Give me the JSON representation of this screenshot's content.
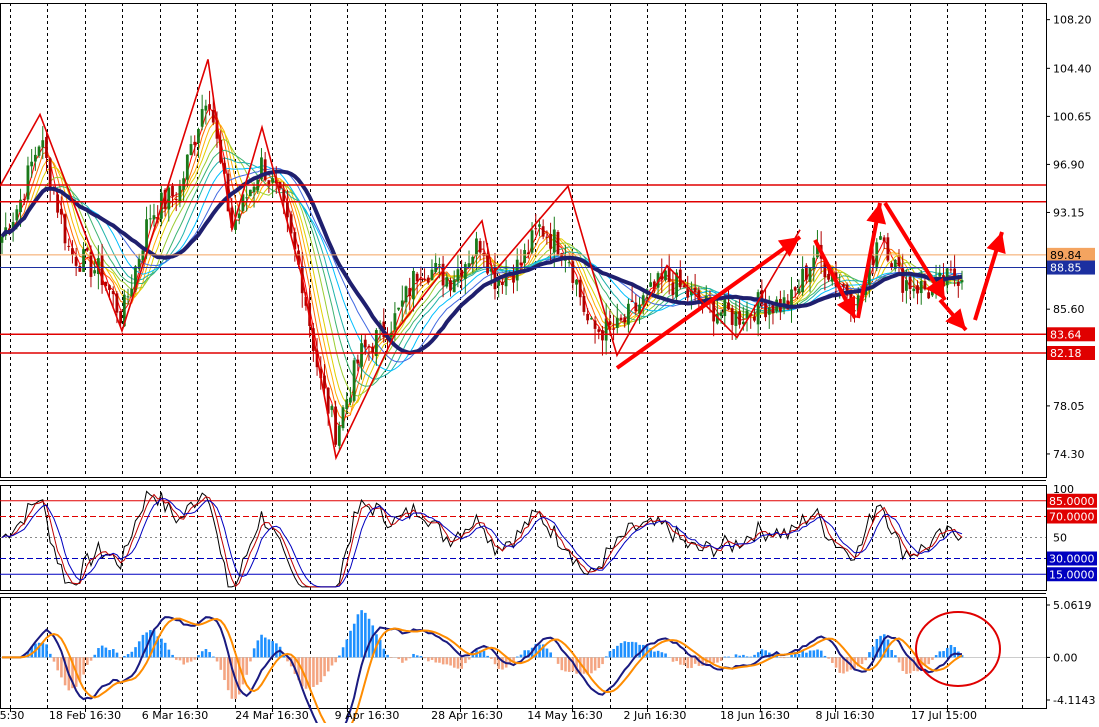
{
  "chart_data": [
    {
      "panel": "price",
      "type": "candlestick",
      "y_ticks": [
        "108.20",
        "104.40",
        "100.65",
        "96.90",
        "93.15",
        "89.84",
        "88.85",
        "85.60",
        "83.64",
        "82.18",
        "78.05",
        "74.30"
      ],
      "ylim": [
        72.5,
        109.5
      ],
      "x_labels": [
        "5:30",
        "18 Feb 16:30",
        "6 Mar 16:30",
        "24 Mar 16:30",
        "9 Apr 16:30",
        "28 Apr 16:30",
        "14 May 16:30",
        "2 Jun 16:30",
        "18 Jun 16:30",
        "8 Jul 16:30",
        "17 Jul 15:00"
      ],
      "horizontal_levels": [
        {
          "value": 95.29,
          "label": "95.29",
          "color": "#e00000"
        },
        {
          "value": 93.99,
          "label": "93.99",
          "color": "#e00000"
        },
        {
          "value": 89.84,
          "label": "89.84",
          "color": "#f4a460"
        },
        {
          "value": 88.85,
          "label": "88.85",
          "color": "#1c2fa0"
        },
        {
          "value": 83.64,
          "label": "83.64",
          "color": "#e00000"
        },
        {
          "value": 82.18,
          "label": "82.18",
          "color": "#e00000"
        }
      ],
      "zigzag": [
        [
          0,
          95.2
        ],
        [
          40,
          100.8
        ],
        [
          122,
          83.9
        ],
        [
          208,
          105.1
        ],
        [
          232,
          91.8
        ],
        [
          262,
          99.8
        ],
        [
          302,
          88.1
        ],
        [
          336,
          74.0
        ],
        [
          397,
          84.0
        ],
        [
          482,
          92.5
        ],
        [
          493,
          88.4
        ],
        [
          568,
          95.2
        ],
        [
          617,
          82.0
        ],
        [
          667,
          89.0
        ],
        [
          737,
          83.4
        ],
        [
          800,
          91.8
        ]
      ],
      "series_color": {
        "up": "#1a7a1a",
        "down": "#b00000",
        "ma": "#1f1f6e"
      }
    },
    {
      "panel": "oscillator",
      "type": "line",
      "y_ticks": [
        "100",
        "85.0000",
        "70.0000",
        "50",
        "30.0000",
        "15.0000"
      ],
      "levels": [
        {
          "value": 85,
          "label": "85.0000",
          "color": "#e00000"
        },
        {
          "value": 70,
          "label": "70.0000",
          "color": "#e00000"
        },
        {
          "value": 30,
          "label": "30.0000",
          "color": "#0000c0"
        },
        {
          "value": 15,
          "label": "15.0000",
          "color": "#0000c0"
        }
      ],
      "ylim": [
        0,
        100
      ]
    },
    {
      "panel": "histogram",
      "type": "bar",
      "y_ticks": [
        "5.0619",
        "0.00",
        "-4.1143"
      ],
      "ylim": [
        -4.1143,
        5.0619
      ],
      "colors": {
        "positive": "#1e90ff",
        "negative": "#f4a582",
        "line1": "#1a1a80",
        "line2": "#ff8c00"
      }
    }
  ]
}
